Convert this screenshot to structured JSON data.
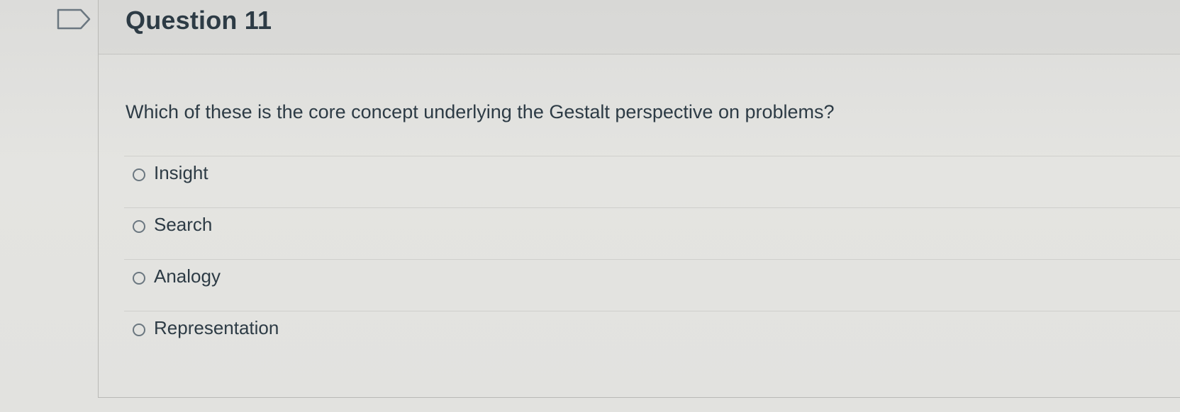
{
  "question": {
    "title": "Question 11",
    "text": "Which of these is the core concept underlying the Gestalt perspective on problems?",
    "flag_icon": "flag-icon",
    "answers": [
      {
        "label": "Insight",
        "selected": false
      },
      {
        "label": "Search",
        "selected": false
      },
      {
        "label": "Analogy",
        "selected": false
      },
      {
        "label": "Representation",
        "selected": false
      }
    ]
  },
  "colors": {
    "text": "#2d3b45",
    "background": "#e2e2df",
    "divider": "#cfcfcc"
  }
}
